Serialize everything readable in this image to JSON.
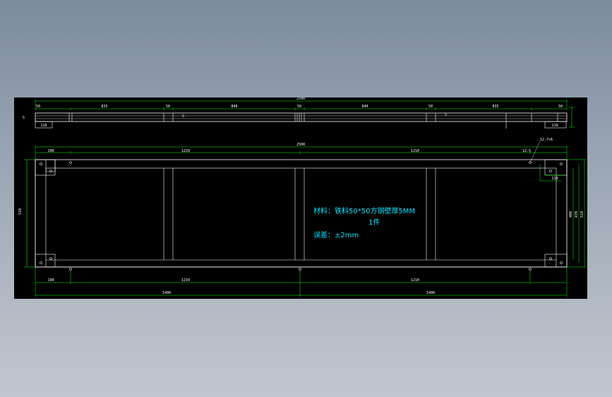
{
  "colors": {
    "background_top": "#7d8b9d",
    "background_bottom": "#c2c7cf",
    "drawing_background": "#000000",
    "outline": "#ffffff",
    "dimension": "#00ff00",
    "note_text": "#00e5ff"
  },
  "notes": {
    "material": "材料：铁料50*50方钢壁厚5MM",
    "quantity": "1件",
    "tolerance": "误差：±2mm"
  },
  "top_view_dims": {
    "overall": "2500",
    "segments": [
      "50",
      "835",
      "50",
      "840",
      "50",
      "840",
      "50",
      "835",
      "50"
    ],
    "end": "110",
    "small": "5"
  },
  "front_view_dims": {
    "overall": "2500",
    "top_row": [
      "190",
      "1210",
      "1210",
      "12.5"
    ],
    "bottom_row": [
      "190",
      "1210",
      "1210"
    ],
    "halves": [
      "1400",
      "1400"
    ],
    "height": "510",
    "right_stack": [
      "400",
      "470",
      "510"
    ],
    "end": "110",
    "hole_label": "12.7×6"
  }
}
